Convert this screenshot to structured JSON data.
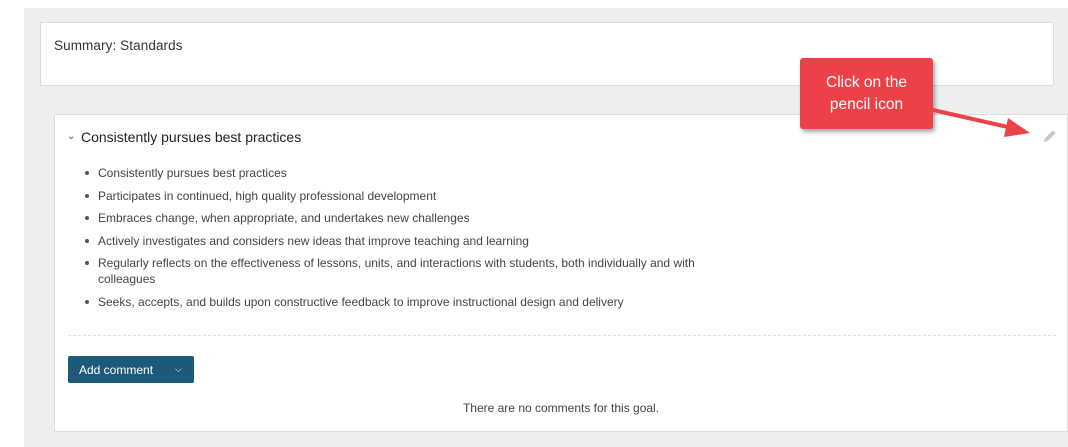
{
  "summary": {
    "title": "Summary: Standards"
  },
  "goal": {
    "title": "Consistently pursues best practices",
    "criteria": [
      "Consistently pursues best practices",
      "Participates in continued, high quality professional development",
      "Embraces change, when appropriate, and undertakes new challenges",
      "Actively investigates and considers new ideas that improve teaching and learning",
      "Regularly reflects on the effectiveness of lessons, units, and interactions with students, both individually and with colleagues",
      "Seeks, accepts, and builds upon constructive feedback to improve instructional design and delivery"
    ],
    "add_comment_label": "Add comment",
    "no_comments_text": "There are no comments for this goal."
  },
  "callout": {
    "line1": "Click on the",
    "line2": "pencil icon"
  },
  "colors": {
    "button": "#1d5a79",
    "callout": "#ec4148",
    "background": "#eeeeee"
  },
  "icons": {
    "collapse": "chevron-down-icon",
    "edit": "pencil-icon",
    "dropdown": "caret-down-icon"
  }
}
